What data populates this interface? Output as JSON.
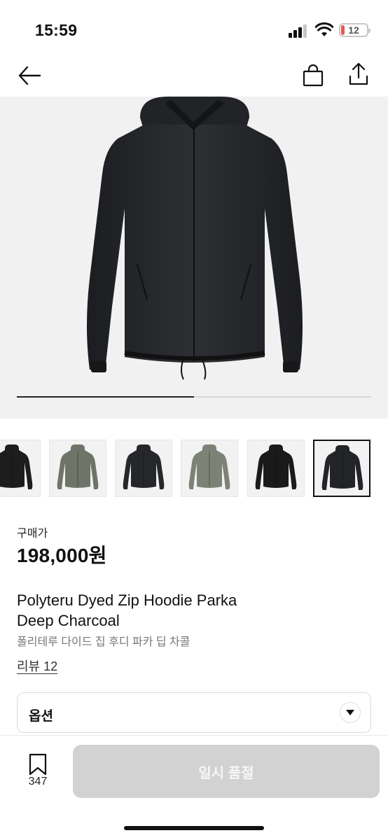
{
  "status_bar": {
    "time": "15:59",
    "battery": "12"
  },
  "icons": {
    "back": "back-arrow-icon",
    "bag": "shopping-bag-icon",
    "share": "share-icon",
    "chevron": "chevron-down-icon",
    "bookmark": "bookmark-icon"
  },
  "gallery": {
    "progress": 0.5
  },
  "thumbnails": [
    {
      "name": "thumb-1",
      "color": "#1d1d1d"
    },
    {
      "name": "thumb-2",
      "color": "#6f7468"
    },
    {
      "name": "thumb-3",
      "color": "#26272b"
    },
    {
      "name": "thumb-4",
      "color": "#7c8275"
    },
    {
      "name": "thumb-5",
      "color": "#1a1a1a"
    },
    {
      "name": "thumb-6",
      "color": "#232427",
      "selected": true
    }
  ],
  "product": {
    "price_label": "구매가",
    "price": "198,000원",
    "title_line1": "Polyteru Dyed Zip Hoodie Parka",
    "title_line2": "Deep Charcoal",
    "subtitle": "폴리테루 다이드 집 후디 파카 딥 차콜",
    "review_link": "리뷰 12"
  },
  "option": {
    "label": "옵션"
  },
  "bottom_bar": {
    "wish_count": "347",
    "soldout_label": "일시 품절"
  },
  "colors": {
    "soldout_bg": "#d2d2d2",
    "battery_low": "#e35a5a"
  }
}
